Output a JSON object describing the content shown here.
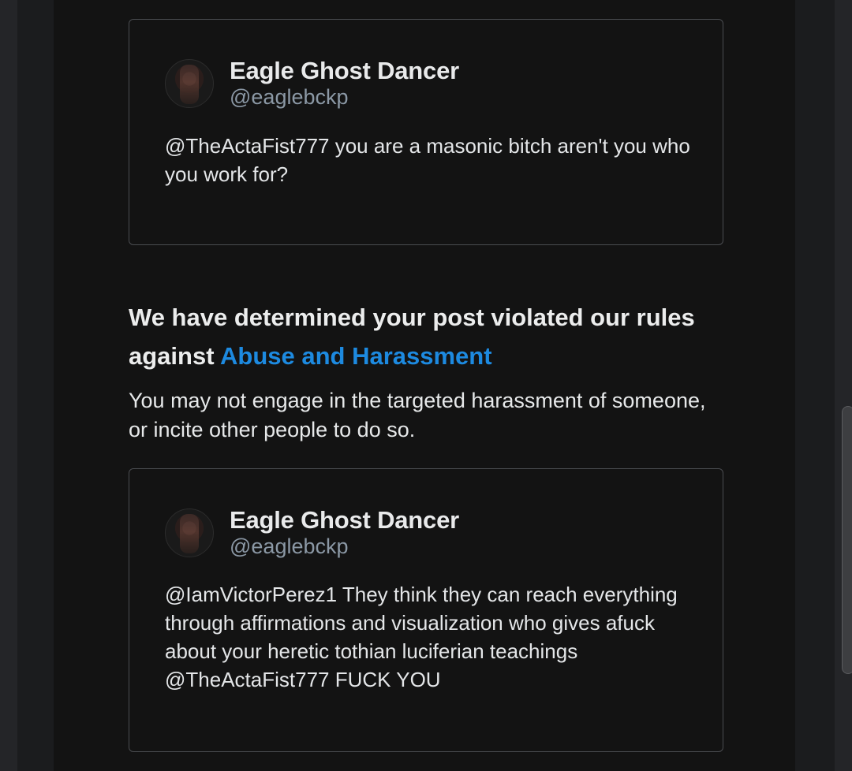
{
  "tweets": [
    {
      "display_name": "Eagle Ghost Dancer",
      "handle": "@eaglebckp",
      "text": "@TheActaFist777 you are a masonic bitch aren't you who you work for?"
    },
    {
      "display_name": "Eagle Ghost Dancer",
      "handle": "@eaglebckp",
      "text": "@IamVictorPerez1 They think they can reach everything through affirmations and visualization who gives afuck about your heretic tothian luciferian teachings @TheActaFist777 FUCK YOU"
    }
  ],
  "violation": {
    "heading_prefix": "We have determined your post violated our rules against",
    "rule_link": "Abuse and Harassment",
    "description": "You may not engage in the targeted harassment of someone, or incite other people to do so."
  },
  "colors": {
    "link": "#1d8ae0",
    "background": "#131313",
    "handle": "#8b98a5"
  },
  "icons": [
    "avatar"
  ]
}
